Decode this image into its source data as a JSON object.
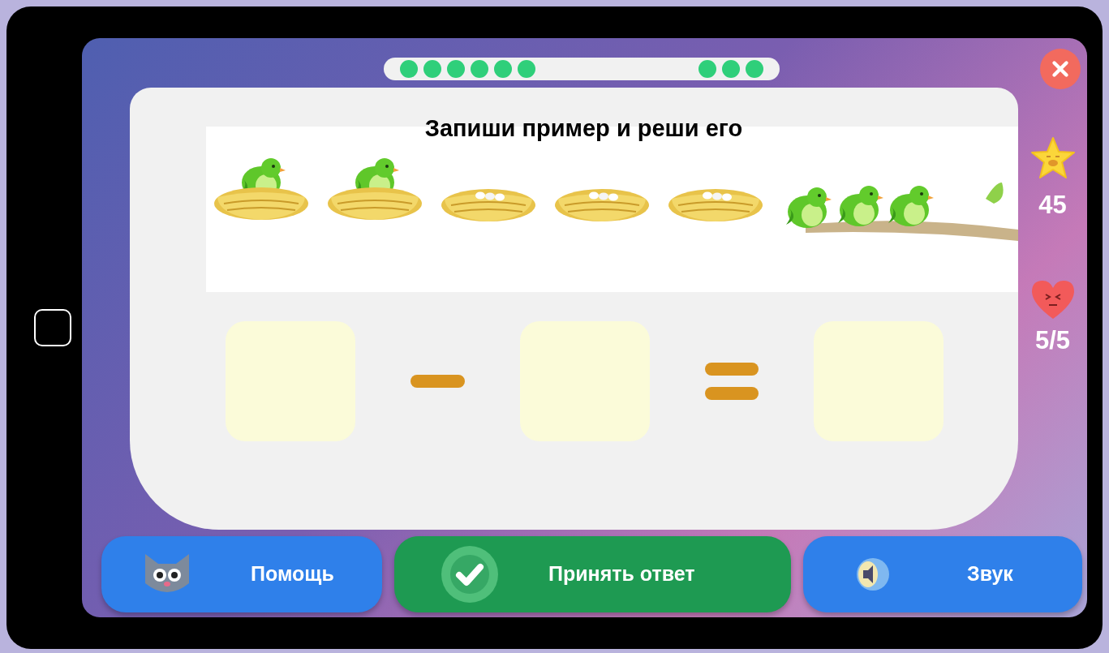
{
  "progress": {
    "segments": [
      {
        "dots": [
          {
            "done": true
          },
          {
            "done": true
          },
          {
            "done": true
          },
          {
            "done": true
          },
          {
            "done": true
          },
          {
            "done": true
          }
        ]
      },
      {
        "dots": [
          {
            "done": true
          },
          {
            "done": true
          },
          {
            "done": true
          }
        ]
      }
    ]
  },
  "task": {
    "title": "Запиши пример и реши его",
    "scene": [
      {
        "kind": "nest-bird"
      },
      {
        "kind": "nest-bird"
      },
      {
        "kind": "nest-eggs"
      },
      {
        "kind": "nest-eggs"
      },
      {
        "kind": "nest-eggs"
      },
      {
        "kind": "branch"
      }
    ],
    "equation": [
      {
        "kind": "box"
      },
      {
        "kind": "minus"
      },
      {
        "kind": "box"
      },
      {
        "kind": "equals"
      },
      {
        "kind": "box"
      }
    ]
  },
  "stats": {
    "stars": "45",
    "lives": "5/5"
  },
  "buttons": [
    {
      "kind": "help",
      "label": "Помощь"
    },
    {
      "kind": "accept",
      "label": "Принять ответ"
    },
    {
      "kind": "sound",
      "label": "Звук"
    }
  ]
}
